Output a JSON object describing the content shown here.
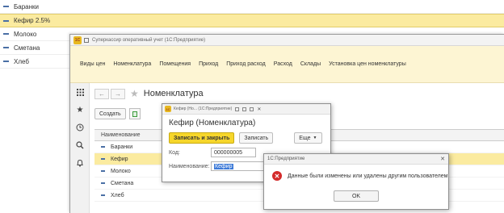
{
  "background_list": [
    {
      "label": "Баранки"
    },
    {
      "label": "Кефир 2.5%"
    },
    {
      "label": "Молоко"
    },
    {
      "label": "Сметана"
    },
    {
      "label": "Хлеб"
    }
  ],
  "main_window": {
    "title": "Суперкассир оперативный учет (1С:Предприятие)",
    "app_logo": "1С",
    "menu": [
      "Виды цен",
      "Номенклатура",
      "Помещения",
      "Приход",
      "Приход расход",
      "Расход",
      "Склады",
      "Установка цен номенклатуры"
    ],
    "sidebar_icons": [
      "apps-grid-icon",
      "star-icon",
      "history-icon",
      "search-icon",
      "bell-icon"
    ],
    "page_title": "Номенклатура",
    "create_label": "Создать",
    "table_header": "Наименование",
    "rows": [
      {
        "label": "Баранки"
      },
      {
        "label": "Кефир"
      },
      {
        "label": "Молоко"
      },
      {
        "label": "Сметана"
      },
      {
        "label": "Хлеб"
      }
    ],
    "selected_row": 1
  },
  "form": {
    "title": "Кефир (Но... (1С:Предприятие)",
    "heading": "Кефир (Номенклатура)",
    "save_close_label": "Записать и закрыть",
    "save_label": "Записать",
    "more_label": "Еще",
    "code_label": "Код:",
    "code_value": "000000005",
    "name_label": "Наименование:",
    "name_value": "Кефир"
  },
  "error_dialog": {
    "title": "1С:Предприятие",
    "message": "Данные были изменены или удалены другим пользователем",
    "ok_label": "OK"
  },
  "colors": {
    "selection": "#fbeba0",
    "menubar": "#fdf5d3",
    "accent_yellow": "#f6d62b",
    "error_red": "#d42b2b"
  }
}
